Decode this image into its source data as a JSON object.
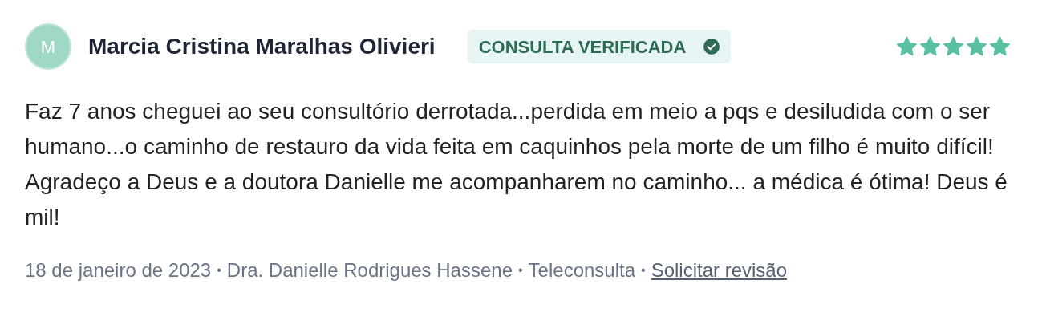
{
  "review": {
    "author": {
      "initial": "M",
      "name": "Marcia Cristina Maralhas Olivieri"
    },
    "badge": {
      "label": "CONSULTA VERIFICADA",
      "verified": true
    },
    "stars": 5,
    "text": "Faz 7 anos cheguei ao seu consultório derrotada...perdida em meio a pqs e desiludida com o ser humano...o caminho de restauro da vida feita em caquinhos pela morte de um filho é muito difícil! Agradeço a Deus e a doutora Danielle me acompanharem no caminho... a médica é ótima! Deus é mil!",
    "footer": [
      {
        "kind": "text",
        "text": "18 de janeiro de 2023"
      },
      {
        "kind": "separator",
        "text": "•"
      },
      {
        "kind": "text",
        "text": "Dra. Danielle Rodrigues Hassene"
      },
      {
        "kind": "separator",
        "text": "•"
      },
      {
        "kind": "text",
        "text": "Teleconsulta"
      },
      {
        "kind": "separator",
        "text": "•"
      },
      {
        "kind": "link",
        "text": "Solicitar revisão"
      }
    ]
  }
}
